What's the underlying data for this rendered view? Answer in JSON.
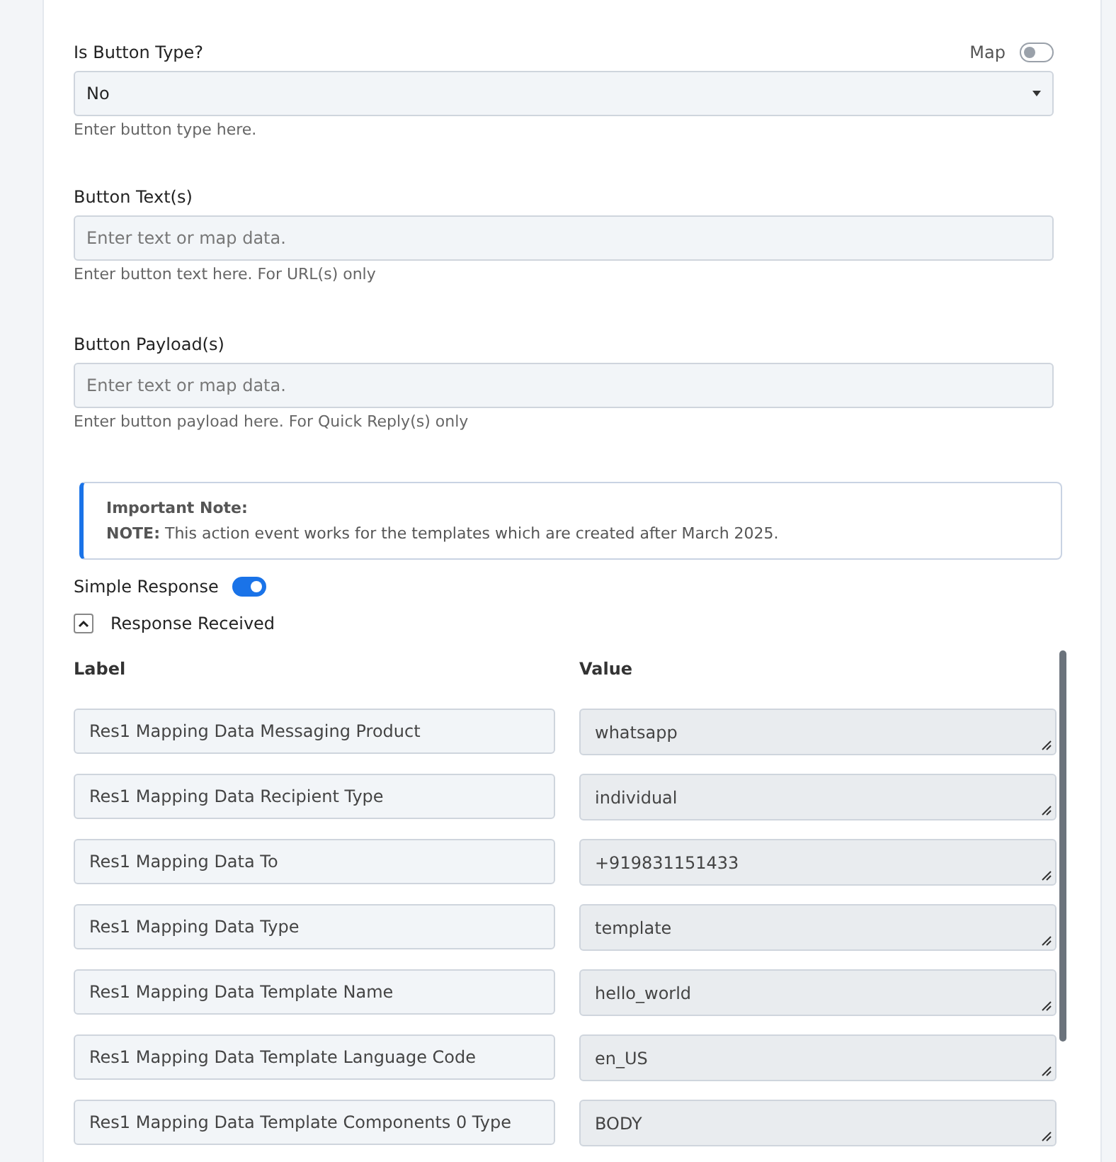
{
  "button_type": {
    "label": "Is Button Type?",
    "map_label": "Map",
    "map_on": false,
    "value": "No",
    "hint": "Enter button type here."
  },
  "button_text": {
    "label": "Button Text(s)",
    "placeholder": "Enter text or map data.",
    "hint": "Enter button text here.  For URL(s) only"
  },
  "button_payload": {
    "label": "Button Payload(s)",
    "placeholder": "Enter text or map data.",
    "hint": "Enter button payload here. For Quick Reply(s) only"
  },
  "note": {
    "title": "Important Note:",
    "text": "**NOTE:** This action event works for the templates which are created after March 2025."
  },
  "simple_response": {
    "label": "Simple Response",
    "on": true
  },
  "response": {
    "title": "Response Received",
    "expanded": true,
    "columns": [
      "Label",
      "Value"
    ],
    "rows": [
      {
        "label": "Res1 Mapping Data Messaging Product",
        "value": "whatsapp"
      },
      {
        "label": "Res1 Mapping Data Recipient Type",
        "value": "individual"
      },
      {
        "label": "Res1 Mapping Data To",
        "value": "+919831151433"
      },
      {
        "label": "Res1 Mapping Data Type",
        "value": "template"
      },
      {
        "label": "Res1 Mapping Data Template Name",
        "value": "hello_world"
      },
      {
        "label": "Res1 Mapping Data Template Language Code",
        "value": "en_US"
      },
      {
        "label": "Res1 Mapping Data Template Components 0 Type",
        "value": "BODY"
      }
    ]
  }
}
